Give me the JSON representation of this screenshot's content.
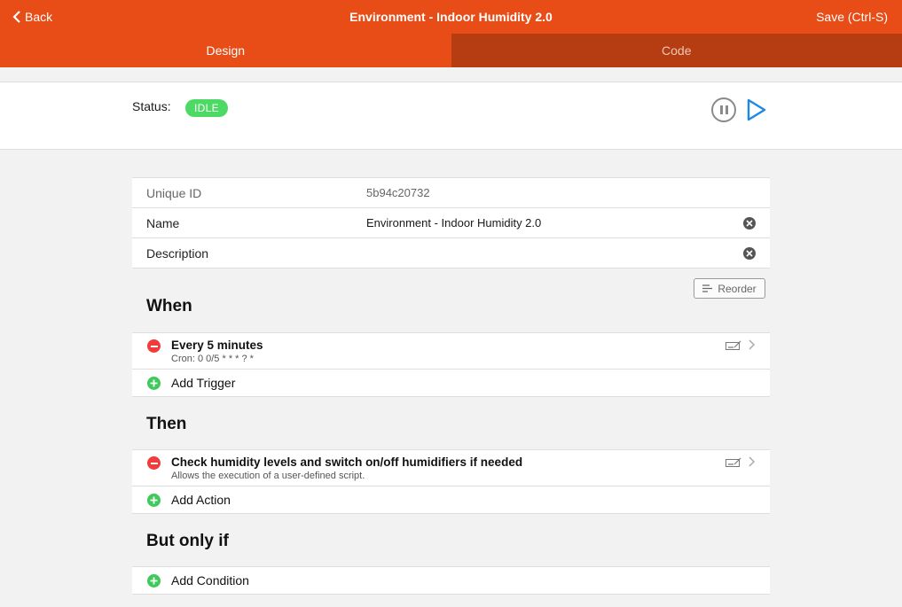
{
  "header": {
    "back_label": "Back",
    "title": "Environment - Indoor Humidity 2.0",
    "save_label": "Save (Ctrl-S)",
    "accent_color": "#e84c17"
  },
  "tabs": [
    {
      "label": "Design",
      "active": true
    },
    {
      "label": "Code",
      "active": false
    }
  ],
  "status": {
    "label": "Status:",
    "value": "IDLE",
    "badge_color": "#4cd964"
  },
  "form": {
    "unique_id_label": "Unique ID",
    "unique_id_value": "5b94c20732",
    "name_label": "Name",
    "name_value": "Environment - Indoor Humidity 2.0",
    "description_label": "Description",
    "description_value": ""
  },
  "reorder_label": "Reorder",
  "when": {
    "title": "When",
    "items": [
      {
        "title": "Every 5 minutes",
        "subtitle": "Cron: 0 0/5 * * * ? *"
      }
    ],
    "add_label": "Add Trigger"
  },
  "then": {
    "title": "Then",
    "items": [
      {
        "title": "Check humidity levels and switch on/off humidifiers if needed",
        "subtitle": "Allows the execution of a user-defined script."
      }
    ],
    "add_label": "Add Action"
  },
  "but_only_if": {
    "title": "But only if",
    "add_label": "Add Condition"
  }
}
